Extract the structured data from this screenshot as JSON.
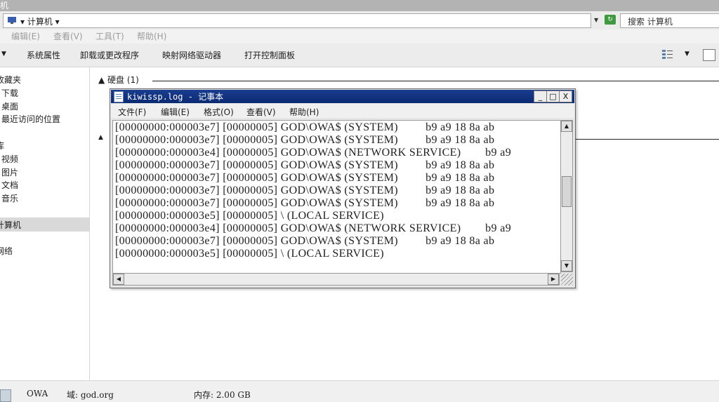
{
  "explorer": {
    "title_fragment": "机",
    "breadcrumb": "计算机",
    "search_placeholder": "搜索 计算机",
    "menu": [
      "编辑(E)",
      "查看(V)",
      "工具(T)",
      "帮助(H)"
    ],
    "toolbar": [
      "系统属性",
      "卸载或更改程序",
      "映射网络驱动器",
      "打开控制面板"
    ],
    "nav": [
      "收藏夹",
      "下载",
      "桌面",
      "最近访问的位置",
      "库",
      "视频",
      "图片",
      "文档",
      "音乐",
      "计算机",
      "网络"
    ],
    "sections": [
      "硬盘 (1)"
    ],
    "status": {
      "name": "OWA",
      "domain": "域: god.org",
      "memory": "内存: 2.00 GB"
    }
  },
  "notepad": {
    "title": "kiwissp.log - 记事本",
    "buttons": [
      "_",
      "□",
      "X"
    ],
    "menu": [
      "文件(F)",
      "编辑(E)",
      "格式(O)",
      "查看(V)",
      "帮助(H)"
    ],
    "lines": [
      "[00000000:000003e7] [00000005] GOD\\OWA$ (SYSTEM)         b9 a9 18 8a ab",
      "[00000000:000003e7] [00000005] GOD\\OWA$ (SYSTEM)         b9 a9 18 8a ab",
      "[00000000:000003e4] [00000005] GOD\\OWA$ (NETWORK SERVICE)        b9 a9",
      "[00000000:000003e7] [00000005] GOD\\OWA$ (SYSTEM)         b9 a9 18 8a ab",
      "[00000000:000003e7] [00000005] GOD\\OWA$ (SYSTEM)         b9 a9 18 8a ab",
      "[00000000:000003e7] [00000005] GOD\\OWA$ (SYSTEM)         b9 a9 18 8a ab",
      "[00000000:000003e7] [00000005] GOD\\OWA$ (SYSTEM)         b9 a9 18 8a ab",
      "[00000000:000003e5] [00000005] \\ (LOCAL SERVICE)",
      "[00000000:000003e4] [00000005] GOD\\OWA$ (NETWORK SERVICE)        b9 a9",
      "[00000000:000003e7] [00000005] GOD\\OWA$ (SYSTEM)         b9 a9 18 8a ab",
      "[00000000:000003e5] [00000005] \\ (LOCAL SERVICE)"
    ]
  },
  "icons": [
    "computer-icon",
    "refresh-icon",
    "notepad-icon",
    "view-options-icon",
    "preview-pane-icon"
  ]
}
